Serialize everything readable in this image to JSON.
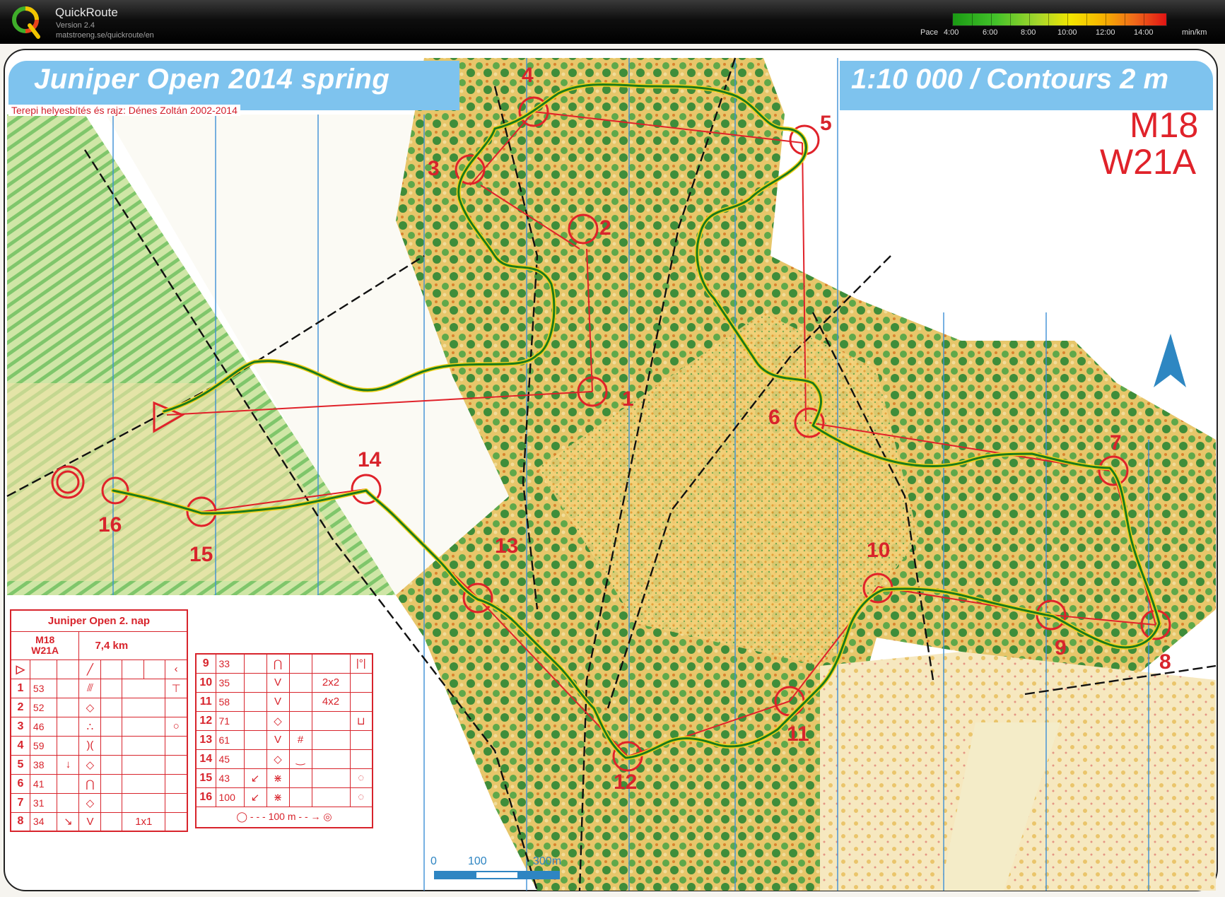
{
  "app": {
    "name": "QuickRoute",
    "version": "Version 2.4",
    "url": "matstroeng.se/quickroute/en",
    "logo_letter": "Q"
  },
  "pace": {
    "label": "Pace",
    "ticks": [
      "4:00",
      "6:00",
      "8:00",
      "10:00",
      "12:00",
      "14:00"
    ],
    "unit": "min/km"
  },
  "map": {
    "title": "Juniper Open 2014 spring",
    "scale_text": "1:10 000 / Contours 2 m",
    "credit": "Terepi helyesbítés és rajz: Dénes Zoltán 2002-2014",
    "classes": [
      "M18",
      "W21A"
    ],
    "north_arrow": "north-arrow-icon",
    "scale_bar": {
      "labels": [
        "0",
        "100",
        "300m"
      ]
    },
    "colors": {
      "route": "#1b7a1b",
      "course": "#e0222a",
      "band": "#7ec3ee",
      "water_lines": "#3d8fd6"
    }
  },
  "controls": [
    {
      "label": "1"
    },
    {
      "label": "2"
    },
    {
      "label": "3"
    },
    {
      "label": "4"
    },
    {
      "label": "5"
    },
    {
      "label": "6"
    },
    {
      "label": "7"
    },
    {
      "label": "8"
    },
    {
      "label": "9"
    },
    {
      "label": "10"
    },
    {
      "label": "11"
    },
    {
      "label": "12"
    },
    {
      "label": "13"
    },
    {
      "label": "14"
    },
    {
      "label": "15"
    },
    {
      "label": "16"
    }
  ],
  "description": {
    "event": "Juniper Open 2. nap",
    "class_line1": "M18",
    "class_line2": "W21A",
    "length": "7,4 km",
    "rows_left": [
      {
        "num": "1",
        "code": "53",
        "c": "",
        "d": "⫻",
        "e": "",
        "f": "",
        "g": "⊤"
      },
      {
        "num": "2",
        "code": "52",
        "c": "",
        "d": "◇",
        "e": "",
        "f": "",
        "g": ""
      },
      {
        "num": "3",
        "code": "46",
        "c": "",
        "d": "∴",
        "e": "",
        "f": "",
        "g": "○"
      },
      {
        "num": "4",
        "code": "59",
        "c": "",
        "d": ")(",
        "e": "",
        "f": "",
        "g": ""
      },
      {
        "num": "5",
        "code": "38",
        "c": "↓",
        "d": "◇",
        "e": "",
        "f": "",
        "g": ""
      },
      {
        "num": "6",
        "code": "41",
        "c": "",
        "d": "⋂",
        "e": "",
        "f": "",
        "g": ""
      },
      {
        "num": "7",
        "code": "31",
        "c": "",
        "d": "◇",
        "e": "",
        "f": "",
        "g": ""
      },
      {
        "num": "8",
        "code": "34",
        "c": "↘",
        "d": "V",
        "e": "",
        "f": "1x1",
        "g": ""
      }
    ],
    "rows_right": [
      {
        "num": "9",
        "code": "33",
        "c": "",
        "d": "⋂",
        "e": "",
        "f": "",
        "g": "|°|"
      },
      {
        "num": "10",
        "code": "35",
        "c": "",
        "d": "V",
        "e": "",
        "f": "2x2",
        "g": ""
      },
      {
        "num": "11",
        "code": "58",
        "c": "",
        "d": "V",
        "e": "",
        "f": "4x2",
        "g": ""
      },
      {
        "num": "12",
        "code": "71",
        "c": "",
        "d": "◇",
        "e": "",
        "f": "",
        "g": "⊔"
      },
      {
        "num": "13",
        "code": "61",
        "c": "",
        "d": "V",
        "e": "#",
        "f": "",
        "g": ""
      },
      {
        "num": "14",
        "code": "45",
        "c": "",
        "d": "◇",
        "e": "‿",
        "f": "",
        "g": ""
      },
      {
        "num": "15",
        "code": "43",
        "c": "↙",
        "d": "⋇",
        "e": "",
        "f": "",
        "g": "◌"
      },
      {
        "num": "16",
        "code": "100",
        "c": "↙",
        "d": "⋇",
        "e": "",
        "f": "",
        "g": "◌"
      }
    ],
    "finish_distance": "100 m"
  }
}
